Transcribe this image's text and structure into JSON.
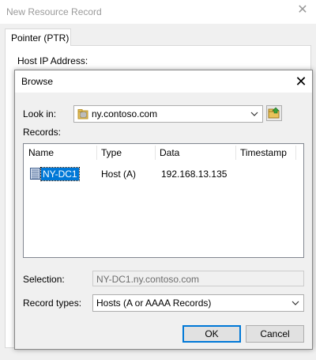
{
  "background": {
    "window_title": "New Resource Record",
    "tab_label": "Pointer (PTR)",
    "host_ip_label": "Host IP Address:"
  },
  "dialog": {
    "title": "Browse",
    "look_in_label": "Look in:",
    "look_in_value": "ny.contoso.com",
    "records_label": "Records:",
    "columns": [
      "Name",
      "Type",
      "Data",
      "Timestamp"
    ],
    "rows": [
      {
        "name": "NY-DC1",
        "type": "Host (A)",
        "data": "192.168.13.135",
        "timestamp": ""
      }
    ],
    "selection_label": "Selection:",
    "selection_value": "NY-DC1.ny.contoso.com",
    "record_types_label": "Record types:",
    "record_types_value": "Hosts (A or AAAA Records)",
    "ok_label": "OK",
    "cancel_label": "Cancel"
  },
  "colors": {
    "selection_highlight": "#0078d7",
    "default_button_border": "#0078d7",
    "window_background": "#f0f0f0"
  },
  "icons": {
    "close": "close-icon",
    "folder_up": "folder-up-icon",
    "zone": "zone-folder-icon",
    "record": "server-record-icon",
    "dropdown": "chevron-down-icon"
  }
}
